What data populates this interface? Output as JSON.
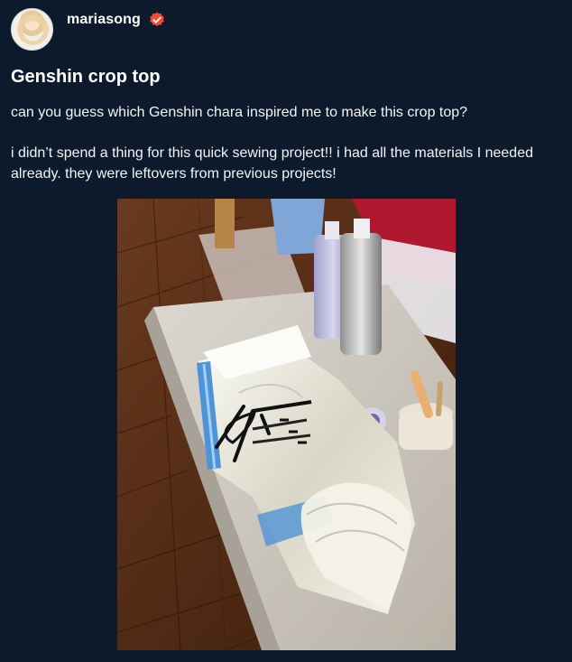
{
  "post": {
    "author": "mariasong",
    "verified": true,
    "title": "Genshin crop top",
    "paragraphs": [
      "can you guess which Genshin chara inspired me to make this crop top?",
      "i didn’t spend a thing for this quick sewing project!! i had all the materials I needed already. they were leftovers from previous projects!"
    ],
    "colors": {
      "background": "#0c1a2b",
      "text": "#ffffff",
      "verified_badge": "#ff4930"
    }
  },
  "icons": {
    "verified": "verified-badge-icon",
    "avatar": "user-avatar"
  }
}
